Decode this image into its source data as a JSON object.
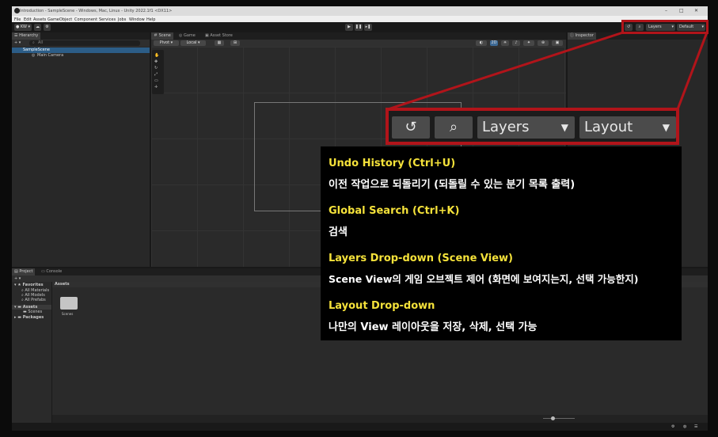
{
  "window": {
    "title": "Introduction - SampleScene - Windows, Mac, Linux - Unity 2022.1f1 <DX11>",
    "controls": [
      "–",
      "□",
      "✕"
    ]
  },
  "menu": [
    "File",
    "Edit",
    "Assets",
    "GameObject",
    "Component",
    "Services",
    "Jobs",
    "Window",
    "Help"
  ],
  "toolbar": {
    "account": "KW",
    "layers_label": "Layers",
    "layout_label": "Default"
  },
  "hierarchy": {
    "tab": "Hierarchy",
    "search_placeholder": "All",
    "scene": "SampleScene",
    "items": [
      "Main Camera"
    ]
  },
  "scene_tabs": [
    "Scene",
    "Game",
    "Asset Store"
  ],
  "scene_toolbar": {
    "pivot": "Pivot",
    "local": "Local"
  },
  "inspector": {
    "tab": "Inspector"
  },
  "project": {
    "tabs": [
      "Project",
      "Console"
    ],
    "favorites_label": "Favorites",
    "favorites": [
      "All Materials",
      "All Models",
      "All Prefabs"
    ],
    "assets_label": "Assets",
    "assets_children": [
      "Scenes"
    ],
    "packages_label": "Packages",
    "breadcrumb": "Assets",
    "folder_name": "Scenes"
  },
  "zoomed": {
    "layers": "Layers",
    "layout": "Layout"
  },
  "tooltip": [
    {
      "heading": "Undo History (Ctrl+U)",
      "desc": "이전 작업으로 되돌리기 (되돌릴 수 있는 분기 목록 출력)"
    },
    {
      "heading": "Global Search (Ctrl+K)",
      "desc": "검색"
    },
    {
      "heading": "Layers Drop-down (Scene View)",
      "desc": "Scene View의 게임 오브젝트 제어 (화면에 보여지는지, 선택 가능한지)"
    },
    {
      "heading": "Layout Drop-down",
      "desc": "나만의 View 레이아웃을 저장, 삭제, 선택 가능"
    }
  ],
  "colors": {
    "highlight": "#b1141a",
    "tip_heading": "#f5e23a"
  }
}
